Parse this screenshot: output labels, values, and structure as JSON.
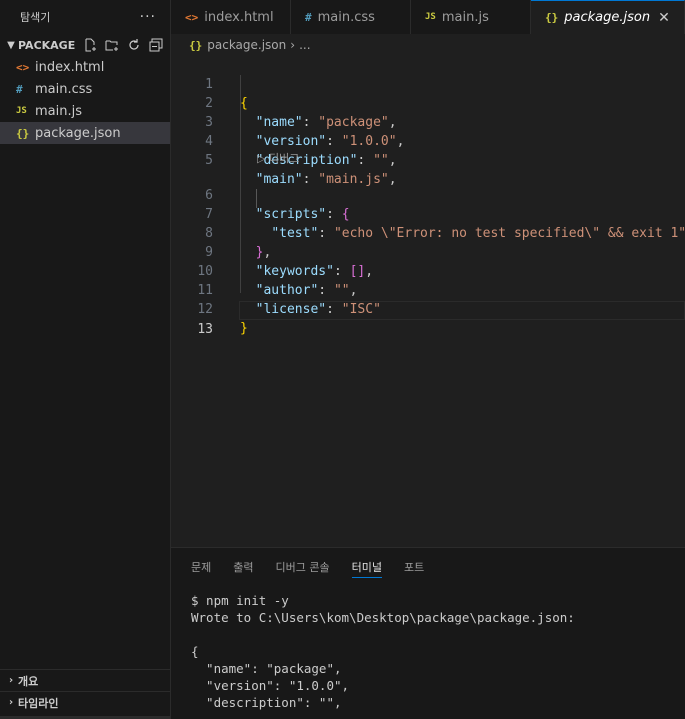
{
  "explorer": {
    "title": "탐색기",
    "more": "···",
    "section": "PACKAGE",
    "files": [
      {
        "icon": "<>",
        "name": "index.html",
        "color": "#e37933"
      },
      {
        "icon": "#",
        "name": "main.css",
        "color": "#519aba"
      },
      {
        "icon": "JS",
        "name": "main.js",
        "color": "#cbcb41"
      },
      {
        "icon": "{}",
        "name": "package.json",
        "color": "#cbcb41"
      }
    ],
    "outline": "개요",
    "timeline": "타임라인"
  },
  "tabs": [
    {
      "icon": "<>",
      "label": "index.html",
      "color": "#e37933"
    },
    {
      "icon": "#",
      "label": "main.css",
      "color": "#519aba"
    },
    {
      "icon": "JS",
      "label": "main.js",
      "color": "#cbcb41"
    },
    {
      "icon": "{}",
      "label": "package.json",
      "color": "#cbcb41",
      "close": "✕"
    }
  ],
  "breadcrumb": {
    "icon": "{}",
    "file": "package.json",
    "sep": "›",
    "more": "..."
  },
  "editor": {
    "line_numbers": [
      "1",
      "2",
      "3",
      "4",
      "5",
      "6",
      "7",
      "8",
      "9",
      "10",
      "11",
      "12",
      "13"
    ],
    "codelens": "디버그",
    "lines": {
      "l1": "{",
      "l2_key": "\"name\"",
      "l2_val": "\"package\"",
      "l3_key": "\"version\"",
      "l3_val": "\"1.0.0\"",
      "l4_key": "\"description\"",
      "l4_val": "\"\"",
      "l5_key": "\"main\"",
      "l5_val": "\"main.js\"",
      "l6_key": "\"scripts\"",
      "l6_brace": "{",
      "l7_key": "\"test\"",
      "l7_val": "\"echo \\\"Error: no test specified\\\" && exit 1\"",
      "l8_brace": "}",
      "l9_key": "\"keywords\"",
      "l9_val": "[]",
      "l10_key": "\"author\"",
      "l10_val": "\"\"",
      "l11_key": "\"license\"",
      "l11_val": "\"ISC\"",
      "l12": "}"
    }
  },
  "panel": {
    "tabs": [
      "문제",
      "출력",
      "디버그 콘솔",
      "터미널",
      "포트"
    ],
    "active_tab": "터미널",
    "terminal": [
      "$ npm init -y",
      "Wrote to C:\\Users\\kom\\Desktop\\package\\package.json:",
      "",
      "{",
      "  \"name\": \"package\",",
      "  \"version\": \"1.0.0\",",
      "  \"description\": \"\","
    ]
  }
}
